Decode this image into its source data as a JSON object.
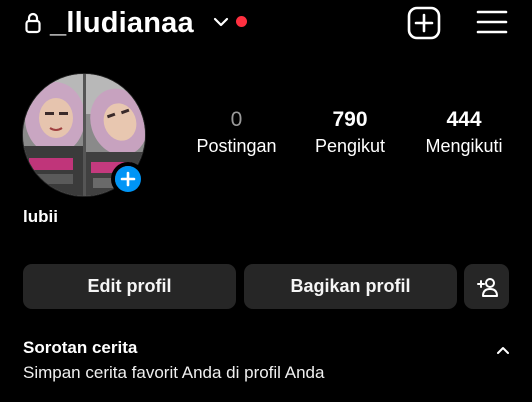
{
  "colors": {
    "background": "#000000",
    "text": "#ffffff",
    "muted_text": "#9a9a9a",
    "button_bg": "#262626",
    "accent_blue": "#0095f6",
    "notification_red": "#ff3040"
  },
  "topbar": {
    "lock_icon": "lock-icon",
    "username": "_lludianaa",
    "chevron_icon": "chevron-down-icon",
    "notification_icon": "notification-dot",
    "create_icon": "plus-square-icon",
    "menu_icon": "hamburger-menu-icon"
  },
  "profile": {
    "avatar_icon": "profile-photo",
    "add_story_icon": "plus-icon",
    "display_name": "lubii",
    "stats": [
      {
        "value": "0",
        "label": "Postingan"
      },
      {
        "value": "790",
        "label": "Pengikut"
      },
      {
        "value": "444",
        "label": "Mengikuti"
      }
    ]
  },
  "actions": {
    "edit_label": "Edit profil",
    "share_label": "Bagikan profil",
    "discover_icon": "add-person-icon"
  },
  "highlights": {
    "title": "Sorotan cerita",
    "subtitle": "Simpan cerita favorit Anda di profil Anda",
    "collapse_icon": "chevron-up-icon"
  }
}
